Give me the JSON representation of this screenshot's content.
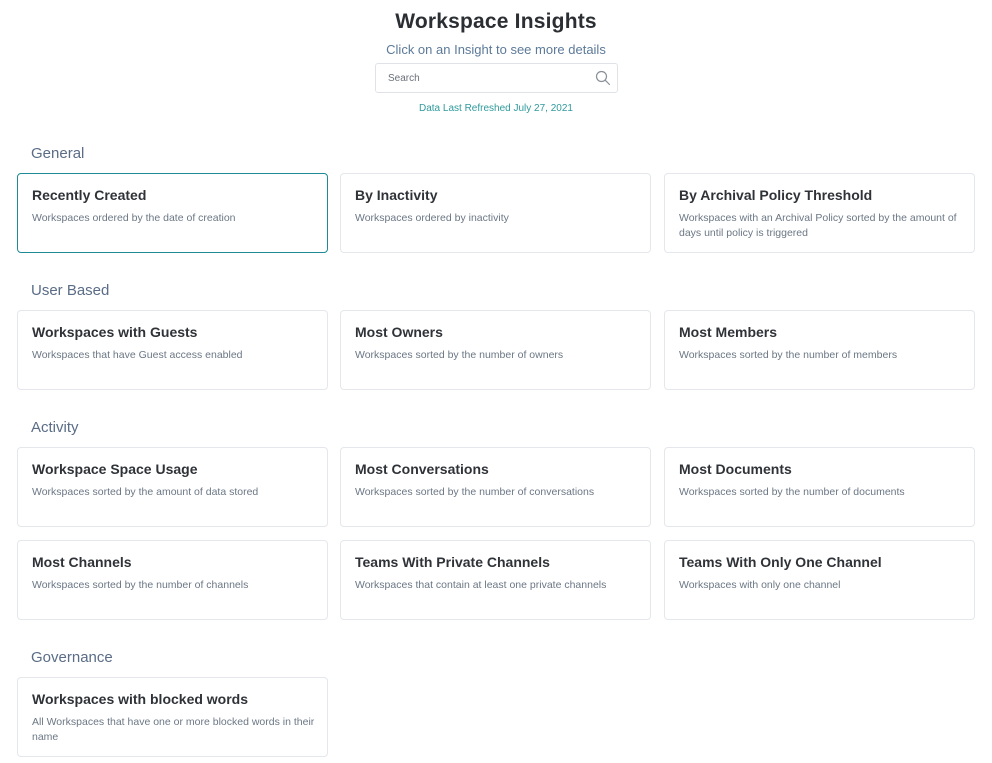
{
  "header": {
    "title": "Workspace Insights",
    "subtitle": "Click on an Insight to see more details",
    "search_placeholder": "Search",
    "refreshed": "Data Last Refreshed July 27, 2021"
  },
  "colors": {
    "accent": "#1e8a93",
    "section_title": "#5a6c86",
    "refresh_text": "#2f9a9c"
  },
  "sections": [
    {
      "title": "General",
      "cards": [
        {
          "title": "Recently Created",
          "desc": "Workspaces ordered by the date of creation"
        },
        {
          "title": "By Inactivity",
          "desc": "Workspaces ordered by inactivity"
        },
        {
          "title": "By Archival Policy Threshold",
          "desc": "Workspaces with an Archival Policy sorted by the amount of days until policy is triggered"
        }
      ]
    },
    {
      "title": "User Based",
      "cards": [
        {
          "title": "Workspaces with Guests",
          "desc": "Workspaces that have Guest access enabled"
        },
        {
          "title": "Most Owners",
          "desc": "Workspaces sorted by the number of owners"
        },
        {
          "title": "Most Members",
          "desc": "Workspaces sorted by the number of members"
        }
      ]
    },
    {
      "title": "Activity",
      "cards": [
        {
          "title": "Workspace Space Usage",
          "desc": "Workspaces sorted by the amount of data stored"
        },
        {
          "title": "Most Conversations",
          "desc": "Workspaces sorted by the number of conversations"
        },
        {
          "title": "Most Documents",
          "desc": "Workspaces sorted by the number of documents"
        },
        {
          "title": "Most Channels",
          "desc": "Workspaces sorted by the number of channels"
        },
        {
          "title": "Teams With Private Channels",
          "desc": "Workspaces that contain at least one private channels"
        },
        {
          "title": "Teams With Only One Channel",
          "desc": "Workspaces with only one channel"
        }
      ]
    },
    {
      "title": "Governance",
      "cards": [
        {
          "title": "Workspaces with blocked words",
          "desc": "All Workspaces that have one or more blocked words in their name"
        }
      ]
    }
  ]
}
